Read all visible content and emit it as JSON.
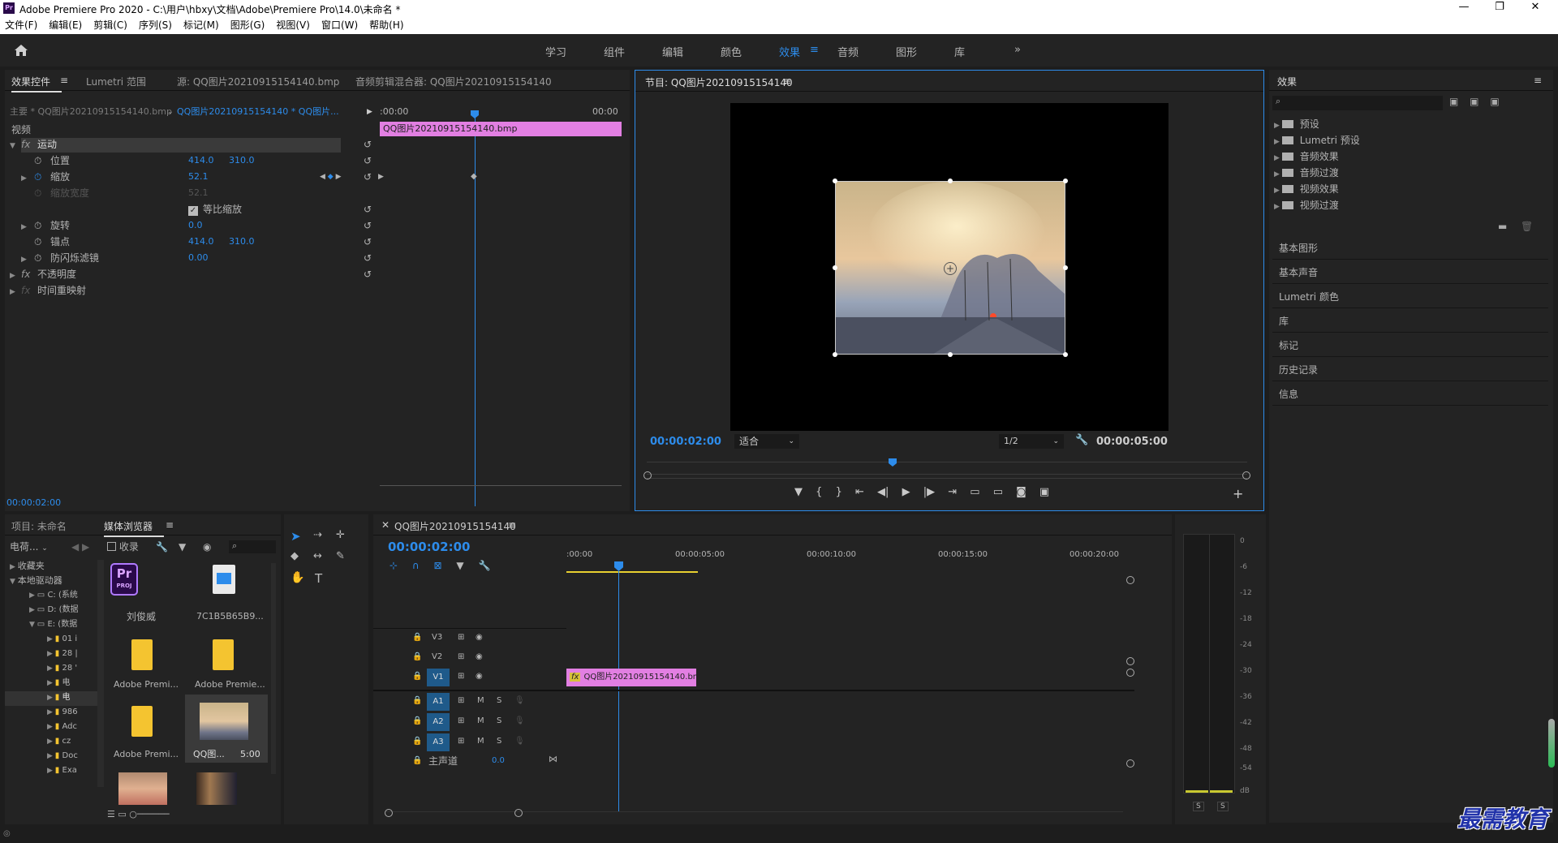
{
  "titlebar": {
    "app_badge": "Pr",
    "title": "Adobe Premiere Pro 2020 - C:\\用户\\hbxy\\文档\\Adobe\\Premiere Pro\\14.0\\未命名 *",
    "minimize": "—",
    "maximize": "❐",
    "close": "✕"
  },
  "menu": [
    "文件(F)",
    "编辑(E)",
    "剪辑(C)",
    "序列(S)",
    "标记(M)",
    "图形(G)",
    "视图(V)",
    "窗口(W)",
    "帮助(H)"
  ],
  "workspaces": [
    {
      "label": "学习",
      "active": false
    },
    {
      "label": "组件",
      "active": false
    },
    {
      "label": "编辑",
      "active": false
    },
    {
      "label": "颜色",
      "active": false
    },
    {
      "label": "效果",
      "active": true
    },
    {
      "label": "音频",
      "active": false
    },
    {
      "label": "图形",
      "active": false
    },
    {
      "label": "库",
      "active": false
    }
  ],
  "ws_more": "»",
  "effect_controls": {
    "tabs": [
      "效果控件",
      "Lumetri 范围",
      "源: QQ图片20210915154140.bmp",
      "音频剪辑混合器: QQ图片20210915154140"
    ],
    "master": "主要 * QQ图片20210915154140.bmp",
    "clip_sel": "QQ图片20210915154140 * QQ图片...",
    "time_start": ":00:00",
    "time_end": "00:00",
    "clip_bar": "QQ图片20210915154140.bmp",
    "section_video": "视频",
    "motion": "运动",
    "props": [
      {
        "label": "位置",
        "v1": "414.0",
        "v2": "310.0"
      },
      {
        "label": "缩放",
        "v1": "52.1",
        "v2": ""
      },
      {
        "label": "缩放宽度",
        "v1": "52.1",
        "v2": ""
      },
      {
        "label": "等比缩放",
        "v1": "",
        "v2": ""
      },
      {
        "label": "旋转",
        "v1": "0.0",
        "v2": ""
      },
      {
        "label": "锚点",
        "v1": "414.0",
        "v2": "310.0"
      },
      {
        "label": "防闪烁滤镜",
        "v1": "0.00",
        "v2": ""
      }
    ],
    "opacity": "不透明度",
    "time_remap": "时间重映射",
    "timecode": "00:00:02:00"
  },
  "program": {
    "title": "节目: QQ图片20210915154140",
    "timecode": "00:00:02:00",
    "fit": "适合",
    "resolution": "1/2",
    "duration": "00:00:05:00"
  },
  "effects_panel": {
    "title": "效果",
    "tree": [
      "预设",
      "Lumetri 预设",
      "音频效果",
      "音频过渡",
      "视频效果",
      "视频过渡"
    ],
    "sections": [
      "基本图形",
      "基本声音",
      "Lumetri 颜色",
      "库",
      "标记",
      "历史记录",
      "信息"
    ]
  },
  "project": {
    "tabs": [
      "项目: 未命名",
      "媒体浏览器"
    ],
    "drive_select": "电荷...",
    "ingest": "收录",
    "tree": [
      "收藏夹",
      "本地驱动器",
      "C: (系统",
      "D: (数据",
      "E: (数据",
      "01 i",
      "28 |",
      "28 '",
      "电",
      "电",
      "986",
      "Adc",
      "cz",
      "Doc",
      "Exa"
    ],
    "items": [
      {
        "name": "刘俊威",
        "type": "proj",
        "badge": "Pr",
        "sub": "PROJ"
      },
      {
        "name": "7C1B5B65B9...",
        "type": "img"
      },
      {
        "name": "Adobe Premi...",
        "type": "folder"
      },
      {
        "name": "Adobe Premie...",
        "type": "folder"
      },
      {
        "name": "Adobe Premi...",
        "type": "folder"
      },
      {
        "name": "QQ图...",
        "type": "thumb",
        "dur": "5:00"
      }
    ]
  },
  "timeline": {
    "tab": "QQ图片20210915154140",
    "timecode": "00:00:02:00",
    "ruler": [
      ":00:00",
      "00:00:05:00",
      "00:00:10:00",
      "00:00:15:00",
      "00:00:20:00"
    ],
    "video_tracks": [
      "V3",
      "V2",
      "V1"
    ],
    "audio_tracks": [
      "A1",
      "A2",
      "A3"
    ],
    "master": "主声道",
    "master_val": "0.0",
    "clip": "QQ图片20210915154140.bm",
    "clip_fx": "fx"
  },
  "vu": {
    "scale": [
      "0",
      "-6",
      "-12",
      "-18",
      "-24",
      "-30",
      "-36",
      "-42",
      "-48",
      "-54",
      "dB"
    ],
    "solo": [
      "S",
      "S"
    ]
  },
  "watermark": "最需教育",
  "colors": {
    "accent": "#2d8ceb",
    "clip": "#e27fe2",
    "bg": "#232323"
  }
}
